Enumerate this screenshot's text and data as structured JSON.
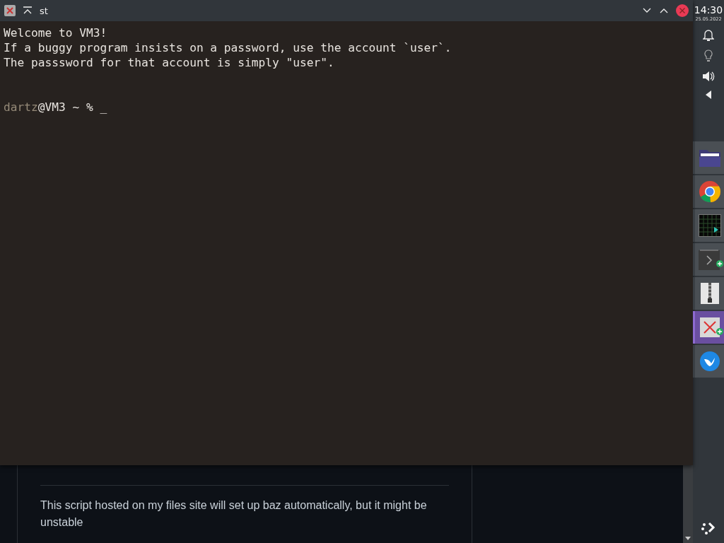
{
  "window": {
    "title": "st"
  },
  "terminal": {
    "lines": [
      "Welcome to VM3!",
      "If a buggy program insists on a password, use the account `user`.",
      "The passsword for that account is simply \"user\"."
    ],
    "prompt": {
      "user": "dartz",
      "host": "@VM3 ~ %",
      "cursor": "_"
    }
  },
  "background_page": {
    "paragraph": "This script hosted on my files site will set up baz automatically, but it might be unstable"
  },
  "panel": {
    "time": "14:30",
    "date": "25.05.2022",
    "dock": [
      {
        "selected": false,
        "badge": false
      },
      {
        "selected": false,
        "badge": false
      },
      {
        "selected": false,
        "badge": false
      },
      {
        "selected": false,
        "badge": true
      },
      {
        "selected": false,
        "badge": false
      },
      {
        "selected": true,
        "badge": true
      },
      {
        "selected": false,
        "badge": false
      }
    ]
  }
}
